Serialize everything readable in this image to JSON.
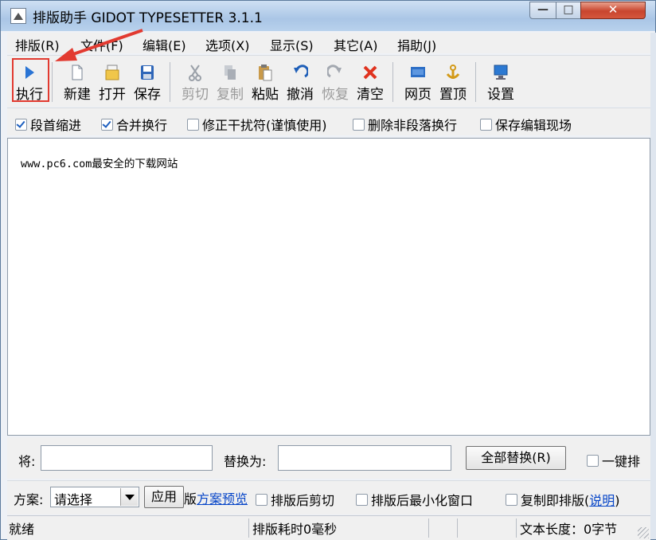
{
  "window": {
    "title": "排版助手 GIDOT TYPESETTER 3.1.1",
    "controls": {
      "minimize": "—",
      "maximize": "□",
      "close": "✕"
    }
  },
  "menu": [
    "排版(R)",
    "文件(F)",
    "编辑(E)",
    "选项(X)",
    "显示(S)",
    "其它(A)",
    "捐助(J)"
  ],
  "toolbar": [
    {
      "label": "执行",
      "icon": "play-icon",
      "enabled": true
    },
    {
      "label": "新建",
      "icon": "new-file-icon",
      "enabled": true
    },
    {
      "label": "打开",
      "icon": "open-icon",
      "enabled": true
    },
    {
      "label": "保存",
      "icon": "save-icon",
      "enabled": true
    },
    {
      "label": "剪切",
      "icon": "cut-icon",
      "enabled": false
    },
    {
      "label": "复制",
      "icon": "copy-icon",
      "enabled": false
    },
    {
      "label": "粘贴",
      "icon": "paste-icon",
      "enabled": true
    },
    {
      "label": "撤消",
      "icon": "undo-icon",
      "enabled": true
    },
    {
      "label": "恢复",
      "icon": "redo-icon",
      "enabled": false
    },
    {
      "label": "清空",
      "icon": "clear-icon",
      "enabled": true
    },
    {
      "label": "网页",
      "icon": "html-icon",
      "enabled": true
    },
    {
      "label": "置顶",
      "icon": "pin-top-icon",
      "enabled": true
    },
    {
      "label": "设置",
      "icon": "settings-monitor-icon",
      "enabled": true
    }
  ],
  "options": [
    {
      "label": "段首缩进",
      "checked": true
    },
    {
      "label": "合并换行",
      "checked": true
    },
    {
      "label": "修正干扰符(谨慎使用)",
      "checked": false
    },
    {
      "label": "删除非段落换行",
      "checked": false
    },
    {
      "label": "保存编辑现场",
      "checked": false
    }
  ],
  "editor": {
    "text": "www.pc6.com最安全的下载网站"
  },
  "replace": {
    "find_label": "将:",
    "find_value": "",
    "replace_label": "替换为:",
    "replace_value": "",
    "replace_all_button": "全部替换(R)",
    "one_key_label": "一键排",
    "one_key_checked": false
  },
  "scheme": {
    "label": "方案:",
    "selected": "请选择",
    "apply_button": "应用",
    "preview_prefix": "版",
    "preview_link": "方案预览",
    "options": [
      {
        "label": "排版后剪切",
        "checked": false
      },
      {
        "label": "排版后最小化窗口",
        "checked": false
      },
      {
        "label": "复制即排版",
        "checked": false
      }
    ],
    "help_open": "(",
    "help_link": "说明",
    "help_close": ")"
  },
  "status": {
    "state": "就绪",
    "elapsed": "排版耗时0毫秒",
    "length": "文本长度：0字节"
  },
  "colors": {
    "highlight": "#e23a30",
    "accent_blue": "#1d5fbf"
  }
}
